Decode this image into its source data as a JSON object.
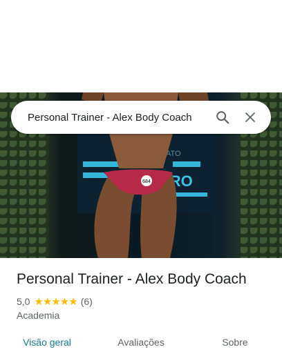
{
  "search": {
    "query": "Personal Trainer - Alex Body Coach",
    "icons": [
      "search-icon",
      "close-icon"
    ]
  },
  "place": {
    "name": "Personal Trainer - Alex Body Coach",
    "rating_value": "5,0",
    "stars": "★★★★★",
    "review_count": "(6)",
    "category": "Academia"
  },
  "tabs": [
    {
      "label": "Visão geral",
      "active": true
    },
    {
      "label": "Avaliações",
      "active": false
    },
    {
      "label": "Sobre",
      "active": false
    }
  ],
  "photo": {
    "stage_text_top": "NATO",
    "stage_text_main": "EIRO",
    "bib_number": "684"
  },
  "colors": {
    "accent": "#1a7a94",
    "star": "#fbbc04",
    "text_primary": "#202124",
    "text_secondary": "#5f6368"
  }
}
